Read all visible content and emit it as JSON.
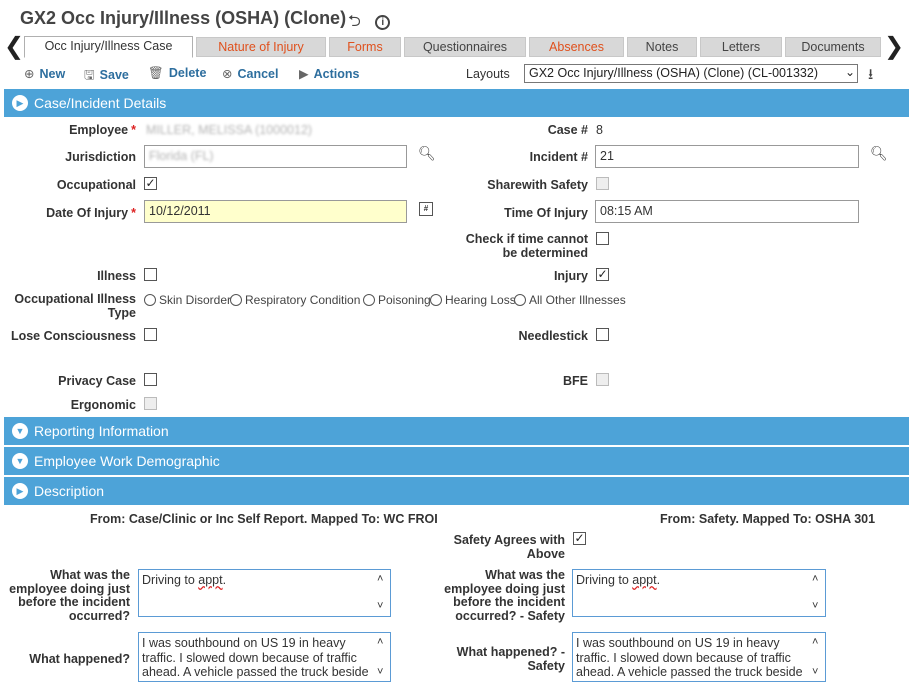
{
  "title": "GX2 Occ Injury/Illness (OSHA) (Clone)",
  "tabs": [
    {
      "label": "Occ Injury/Illness Case"
    },
    {
      "label": "Nature of Injury"
    },
    {
      "label": "Forms"
    },
    {
      "label": "Questionnaires"
    },
    {
      "label": "Absences"
    },
    {
      "label": "Notes"
    },
    {
      "label": "Letters"
    },
    {
      "label": "Documents"
    }
  ],
  "toolbar": {
    "new": "New",
    "save": "Save",
    "delete": "Delete",
    "cancel": "Cancel",
    "actions": "Actions",
    "layouts_label": "Layouts",
    "layouts_value": "GX2 Occ Injury/Illness (OSHA) (Clone) (CL-001332)"
  },
  "sections": {
    "case": "Case/Incident Details",
    "reporting": "Reporting Information",
    "demographic": "Employee Work Demographic",
    "description": "Description"
  },
  "form": {
    "employee_label": "Employee",
    "employee_value": "MILLER, MELISSA (1000012)",
    "case_label": "Case #",
    "case_value": "8",
    "jurisdiction_label": "Jurisdiction",
    "jurisdiction_value": "Florida (FL)",
    "incident_label": "Incident #",
    "incident_value": "21",
    "occupational_label": "Occupational",
    "sharewith_label": "Sharewith Safety",
    "doi_label": "Date Of Injury",
    "doi_value": "10/12/2011",
    "toi_label": "Time Of Injury",
    "toi_value": "08:15 AM",
    "time_cannot_l1": "Check if time cannot",
    "time_cannot_l2": "be determined",
    "illness_label": "Illness",
    "injury_label": "Injury",
    "occ_illness_type_l1": "Occupational Illness",
    "occ_illness_type_l2": "Type",
    "illness_types": [
      "Skin Disorder",
      "Respiratory Condition",
      "Poisoning",
      "Hearing Loss",
      "All Other Illnesses"
    ],
    "lose_consciousness_label": "Lose Consciousness",
    "needlestick_label": "Needlestick",
    "privacy_label": "Privacy Case",
    "bfe_label": "BFE",
    "ergonomic_label": "Ergonomic"
  },
  "description": {
    "from_left": "From: Case/Clinic or Inc Self Report. Mapped To: WC FROI",
    "from_right": "From: Safety. Mapped To: OSHA 301",
    "safety_agrees_l1": "Safety Agrees with",
    "safety_agrees_l2": "Above",
    "doing_l1": "What was the",
    "doing_l2": "employee doing just",
    "doing_l3": "before the incident",
    "doing_l4": "occurred?",
    "doing_safety_l1": "What was the",
    "doing_safety_l2": "employee doing just",
    "doing_safety_l3": "before the incident",
    "doing_safety_l4": "occurred? - Safety",
    "doing_value_pre": "Driving to ",
    "doing_value_word": "appt",
    "doing_value_post": ".",
    "happened_label": "What happened?",
    "happened_safety_l1": "What happened? -",
    "happened_safety_l2": "Safety",
    "happened_value_l1": "I was southbound on US 19 in heavy",
    "happened_value_l2": "traffic. I slowed down because of traffic",
    "happened_value_l3": "ahead. A vehicle passed the truck beside"
  }
}
